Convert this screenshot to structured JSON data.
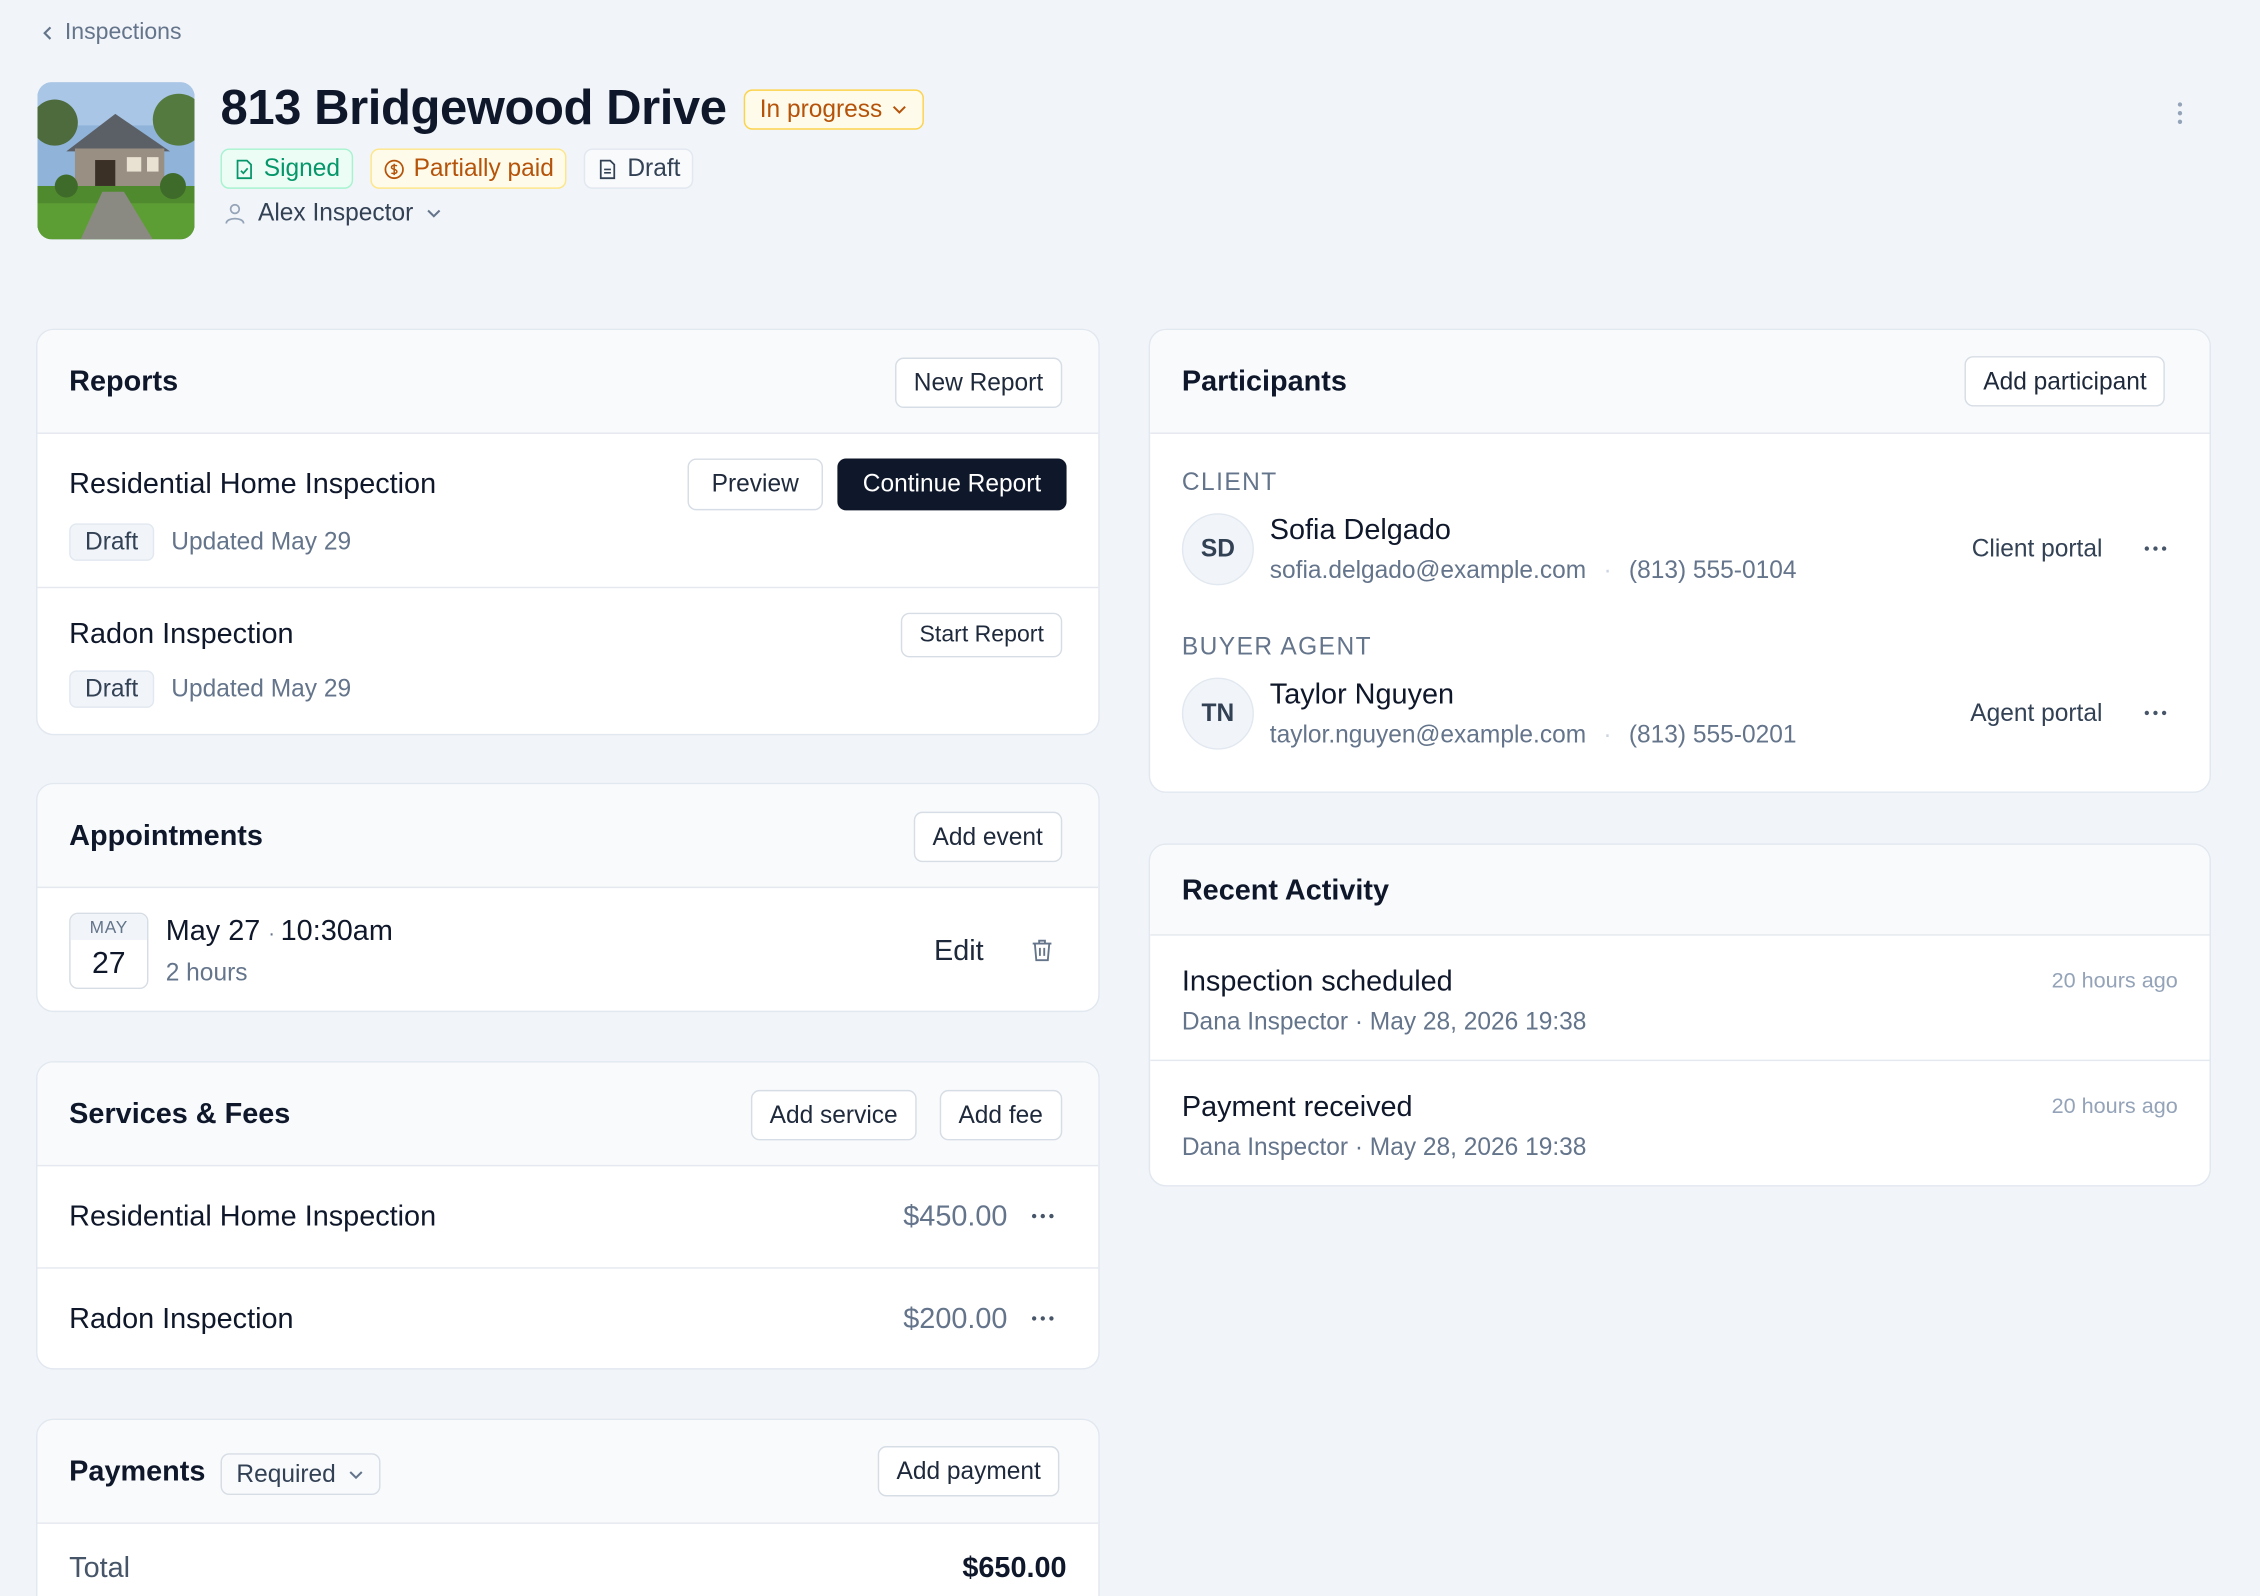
{
  "breadcrumb": {
    "label": "Inspections"
  },
  "header": {
    "title": "813 Bridgewood Drive",
    "status": "In progress",
    "badges": {
      "signed": "Signed",
      "paid": "Partially paid",
      "draft": "Draft"
    },
    "inspector": "Alex Inspector"
  },
  "reports": {
    "title": "Reports",
    "new_button": "New Report",
    "items": [
      {
        "name": "Residential Home Inspection",
        "status": "Draft",
        "updated": "Updated May 29",
        "preview": "Preview",
        "action": "Continue Report"
      },
      {
        "name": "Radon Inspection",
        "status": "Draft",
        "updated": "Updated May 29",
        "action": "Start Report"
      }
    ]
  },
  "appointments": {
    "title": "Appointments",
    "add_button": "Add event",
    "items": [
      {
        "month": "MAY",
        "day": "27",
        "date": "May 27",
        "time": "10:30am",
        "duration": "2 hours",
        "edit": "Edit"
      }
    ]
  },
  "services": {
    "title": "Services & Fees",
    "add_service": "Add service",
    "add_fee": "Add fee",
    "items": [
      {
        "name": "Residential Home Inspection",
        "price": "$450.00"
      },
      {
        "name": "Radon Inspection",
        "price": "$200.00"
      }
    ]
  },
  "payments": {
    "title": "Payments",
    "requirement": "Required",
    "add_button": "Add payment",
    "total_label": "Total",
    "total_value": "$650.00"
  },
  "participants": {
    "title": "Participants",
    "add_button": "Add participant",
    "items": [
      {
        "role": "CLIENT",
        "initials": "SD",
        "name": "Sofia Delgado",
        "email": "sofia.delgado@example.com",
        "phone": "(813) 555-0104",
        "portal": "Client portal"
      },
      {
        "role": "BUYER AGENT",
        "initials": "TN",
        "name": "Taylor Nguyen",
        "email": "taylor.nguyen@example.com",
        "phone": "(813) 555-0201",
        "portal": "Agent portal"
      }
    ]
  },
  "activity": {
    "title": "Recent Activity",
    "items": [
      {
        "title": "Inspection scheduled",
        "meta": "Dana Inspector · May 28, 2026 19:38",
        "time": "20 hours ago"
      },
      {
        "title": "Payment received",
        "meta": "Dana Inspector · May 28, 2026 19:38",
        "time": "20 hours ago"
      }
    ]
  },
  "colors": {
    "accent_dark": "#0f172a",
    "status_amber": "#b45309",
    "signed_green": "#059669",
    "background": "#f1f4f8"
  }
}
